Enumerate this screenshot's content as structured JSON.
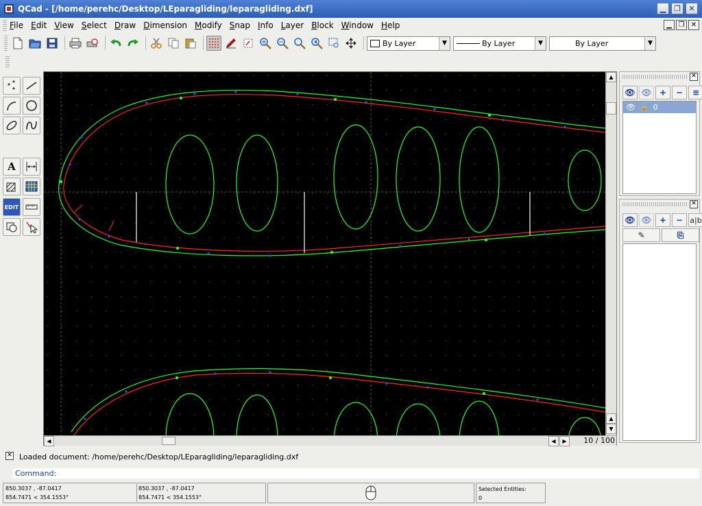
{
  "window": {
    "title": "QCad - [/home/perehc/Desktop/LEparagliding/leparagliding.dxf]"
  },
  "menu": [
    "File",
    "Edit",
    "View",
    "Select",
    "Draw",
    "Dimension",
    "Modify",
    "Snap",
    "Info",
    "Layer",
    "Block",
    "Window",
    "Help"
  ],
  "toolbar": {
    "color_combo": "By Layer",
    "linetype_combo": "By Layer",
    "linewidth_combo": "By Layer"
  },
  "icons": {
    "new": "new-document-icon",
    "open": "open-folder-icon",
    "save": "save-icon",
    "print": "print-icon",
    "print_preview": "print-preview-icon",
    "undo": "undo-icon",
    "redo": "redo-icon",
    "cut": "cut-icon",
    "copy": "copy-icon",
    "paste": "paste-icon",
    "grid": "grid-icon",
    "draft": "draft-icon",
    "redraw": "redraw-icon",
    "zoom_in": "zoom-in-icon",
    "zoom_out": "zoom-out-icon",
    "zoom_auto": "zoom-auto-icon",
    "zoom_prev": "zoom-previous-icon",
    "zoom_window": "zoom-window-icon",
    "zoom_pan": "zoom-pan-icon"
  },
  "canvas": {
    "page_info": "10 / 100",
    "background": "#000000",
    "outline_color": "#22ff22",
    "inner_color": "#ff2222"
  },
  "layers": {
    "items": [
      {
        "name": "0"
      }
    ]
  },
  "command": {
    "message": "Loaded document: /home/perehc/Desktop/LEparagliding/leparagliding.dxf",
    "label": "Command:"
  },
  "status": {
    "abs_coord": "850.3037 , -87.0417",
    "abs_polar": "854.7471 < 354.1553°",
    "rel_coord": "850.3037 , -87.0417",
    "rel_polar": "854.7471 < 354.1553°",
    "selected_label": "Selected Entities:",
    "selected_count": "0"
  }
}
